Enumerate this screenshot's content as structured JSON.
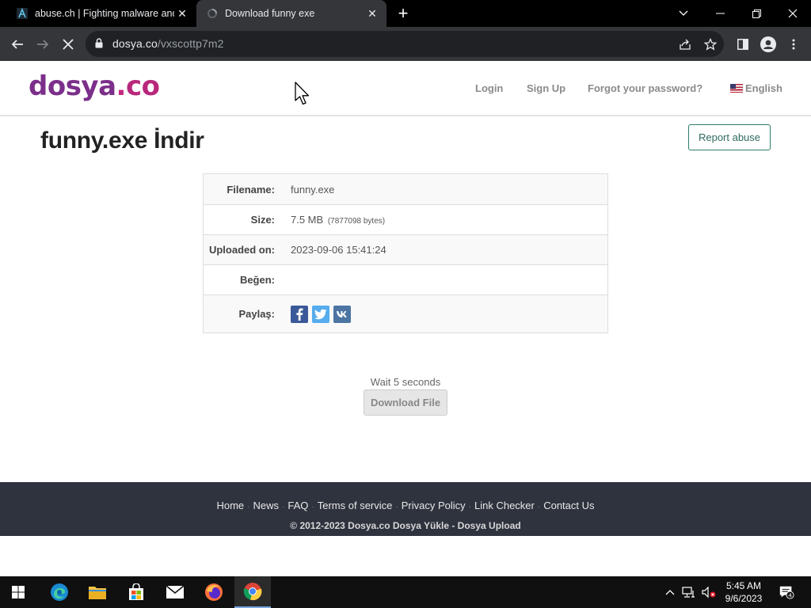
{
  "browser": {
    "tabs": [
      {
        "title": "abuse.ch | Fighting malware and",
        "active": false
      },
      {
        "title": "Download funny exe",
        "active": true
      }
    ],
    "url_domain": "dosya.co",
    "url_path": "/vxscottp7m2"
  },
  "site": {
    "logo_main": "dosya",
    "logo_dot": ".",
    "logo_co": "co",
    "nav": {
      "login": "Login",
      "signup": "Sign Up",
      "forgot": "Forgot your password?",
      "language": "English"
    }
  },
  "main": {
    "title": "funny.exe İndir",
    "report_abuse": "Report abuse",
    "file_info": {
      "filename_label": "Filename:",
      "filename": "funny.exe",
      "size_label": "Size:",
      "size": "7.5 MB",
      "size_bytes": "(7877098 bytes)",
      "uploaded_label": "Uploaded on:",
      "uploaded": "2023-09-06 15:41:24",
      "like_label": "Beğen:",
      "share_label": "Paylaş:"
    },
    "wait_text": "Wait 5 seconds",
    "download_button": "Download File"
  },
  "footer": {
    "links": [
      "Home",
      "News",
      "FAQ",
      "Terms of service",
      "Privacy Policy",
      "Link Checker",
      "Contact Us"
    ],
    "copyright": "© 2012-2023 Dosya.co Dosya Yükle - Dosya Upload"
  },
  "taskbar": {
    "time": "5:45 AM",
    "date": "9/6/2023",
    "notification_count": "4"
  },
  "colors": {
    "logo_purple": "#7b2f8a",
    "logo_pink": "#c3297f",
    "footer_bg": "#2f333e",
    "report_border": "#2e7d6b"
  }
}
